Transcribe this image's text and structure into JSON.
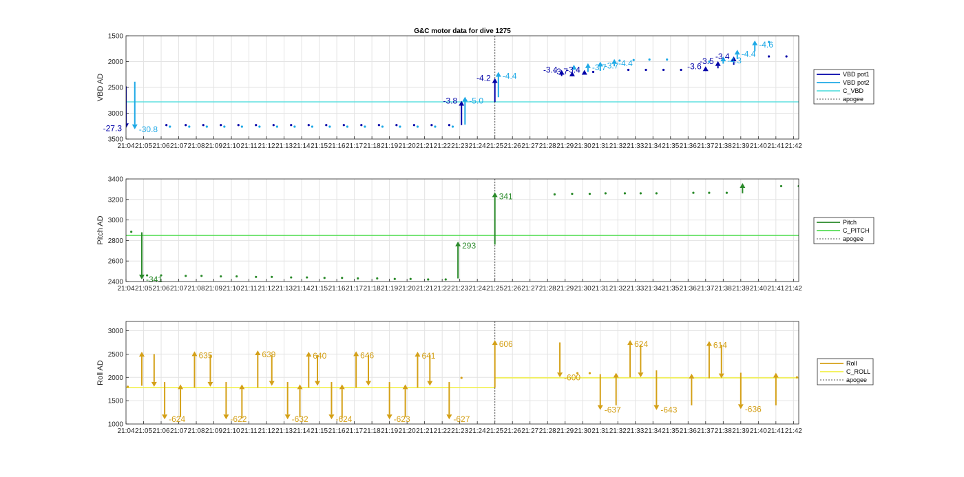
{
  "chart_data": [
    {
      "type": "scatter",
      "title": "G&C motor data for dive 1275",
      "ylabel": "VBD AD",
      "xlabel": "",
      "y_reversed": true,
      "ylim": [
        1500,
        3500
      ],
      "yticks": [
        1500,
        2000,
        2500,
        3000,
        3500
      ],
      "xticks": [
        "21:04",
        "21:05",
        "21:06",
        "21:07",
        "21:08",
        "21:09",
        "21:10",
        "21:11",
        "21:12",
        "21:13",
        "21:14",
        "21:15",
        "21:16",
        "21:17",
        "21:18",
        "21:19",
        "21:20",
        "21:21",
        "21:22",
        "21:23",
        "21:24",
        "21:25",
        "21:26",
        "21:27",
        "21:28",
        "21:29",
        "21:30",
        "21:31",
        "21:32",
        "21:33",
        "21:34",
        "21:35",
        "21:36",
        "21:37",
        "21:38",
        "21:39",
        "21:40",
        "21:41",
        "21:42"
      ],
      "grid": true,
      "legend": {
        "placement": "right",
        "entries": [
          "VBD pot1",
          "VBD pot2",
          "C_VBD",
          "apogee"
        ]
      },
      "colors": {
        "pot1": "#0000a8",
        "pot2": "#1ea9e6",
        "c_line": "#5fe0e0",
        "apogee": "#555555"
      },
      "apogee_min": 25.0,
      "c_value": 2780,
      "series": [
        {
          "name": "VBD pot1",
          "points": [
            [
              6.3,
              3230
            ],
            [
              7.4,
              3230
            ],
            [
              8.4,
              3230
            ],
            [
              9.4,
              3230
            ],
            [
              10.4,
              3230
            ],
            [
              11.4,
              3230
            ],
            [
              12.4,
              3230
            ],
            [
              13.4,
              3230
            ],
            [
              14.4,
              3230
            ],
            [
              15.4,
              3230
            ],
            [
              16.4,
              3230
            ],
            [
              17.4,
              3230
            ],
            [
              18.4,
              3230
            ],
            [
              19.4,
              3230
            ],
            [
              20.4,
              3230
            ],
            [
              21.4,
              3230
            ],
            [
              22.4,
              3230
            ],
            [
              30.6,
              2200
            ],
            [
              32.6,
              2160
            ],
            [
              33.6,
              2160
            ],
            [
              34.6,
              2160
            ],
            [
              35.6,
              2160
            ],
            [
              40.6,
              1900
            ],
            [
              41.6,
              1900
            ]
          ],
          "arrows": [
            {
              "x0": 4.0,
              "y0": 2480,
              "y1": 3290,
              "label": "-27.3"
            },
            {
              "x0": 23.1,
              "y0": 3230,
              "y1": 2760,
              "label": "-3.8"
            },
            {
              "x0": 25.0,
              "y0": 2780,
              "y1": 2320,
              "label": "-4.2"
            },
            {
              "x0": 28.8,
              "y0": 2280,
              "y1": 2160,
              "label": "-3.4"
            },
            {
              "x0": 29.4,
              "y0": 2270,
              "y1": 2190,
              "label": "-3.7"
            },
            {
              "x0": 30.1,
              "y0": 2240,
              "y1": 2160,
              "label": "-3.4"
            },
            {
              "x0": 37.0,
              "y0": 2160,
              "y1": 2090,
              "label": "-3.6"
            },
            {
              "x0": 37.7,
              "y0": 2130,
              "y1": 1990,
              "label": "-3.5"
            },
            {
              "x0": 38.6,
              "y0": 2060,
              "y1": 1900,
              "label": "-3.4"
            }
          ]
        },
        {
          "name": "VBD pot2",
          "points": [
            [
              6.5,
              3260
            ],
            [
              7.6,
              3260
            ],
            [
              8.6,
              3260
            ],
            [
              9.6,
              3260
            ],
            [
              10.6,
              3260
            ],
            [
              11.6,
              3260
            ],
            [
              12.6,
              3260
            ],
            [
              13.6,
              3260
            ],
            [
              14.6,
              3260
            ],
            [
              15.6,
              3260
            ],
            [
              16.6,
              3260
            ],
            [
              17.6,
              3260
            ],
            [
              18.6,
              3260
            ],
            [
              19.6,
              3260
            ],
            [
              20.6,
              3260
            ],
            [
              21.6,
              3260
            ],
            [
              22.6,
              3260
            ],
            [
              32.1,
              1980
            ],
            [
              32.9,
              1970
            ],
            [
              33.8,
              1960
            ],
            [
              34.8,
              1960
            ],
            [
              37.2,
              2000
            ],
            [
              40.6,
              1620
            ]
          ],
          "arrows": [
            {
              "x0": 4.5,
              "y0": 2390,
              "y1": 3310,
              "label": "-30.8"
            },
            {
              "x0": 23.3,
              "y0": 3220,
              "y1": 2680,
              "label": "-5.0"
            },
            {
              "x0": 25.2,
              "y0": 2690,
              "y1": 2200,
              "label": "-4.4"
            },
            {
              "x0": 29.5,
              "y0": 2160,
              "y1": 2060,
              "label": ""
            },
            {
              "x0": 30.3,
              "y0": 2200,
              "y1": 2030,
              "label": "-3.7"
            },
            {
              "x0": 31.0,
              "y0": 2180,
              "y1": 2000,
              "label": "-3.7"
            },
            {
              "x0": 31.8,
              "y0": 2090,
              "y1": 1950,
              "label": "-4.4"
            },
            {
              "x0": 38.0,
              "y0": 2040,
              "y1": 1900,
              "label": "-4.3"
            },
            {
              "x0": 38.8,
              "y0": 1950,
              "y1": 1770,
              "label": "-4.4"
            },
            {
              "x0": 39.8,
              "y0": 1800,
              "y1": 1590,
              "label": "-4.6"
            }
          ]
        }
      ]
    },
    {
      "type": "scatter",
      "title": "",
      "ylabel": "Pitch AD",
      "xlabel": "",
      "y_reversed": false,
      "ylim": [
        2400,
        3400
      ],
      "yticks": [
        2400,
        2600,
        2800,
        3000,
        3200,
        3400
      ],
      "xticks": [
        "21:04",
        "21:05",
        "21:06",
        "21:07",
        "21:08",
        "21:09",
        "21:10",
        "21:11",
        "21:12",
        "21:13",
        "21:14",
        "21:15",
        "21:16",
        "21:17",
        "21:18",
        "21:19",
        "21:20",
        "21:21",
        "21:22",
        "21:23",
        "21:24",
        "21:25",
        "21:26",
        "21:27",
        "21:28",
        "21:29",
        "21:30",
        "21:31",
        "21:32",
        "21:33",
        "21:34",
        "21:35",
        "21:36",
        "21:37",
        "21:38",
        "21:39",
        "21:40",
        "21:41",
        "21:42"
      ],
      "grid": true,
      "legend": {
        "placement": "right",
        "entries": [
          "Pitch",
          "C_PITCH",
          "apogee"
        ]
      },
      "colors": {
        "main": "#2a8a2a",
        "c_line": "#55dd55",
        "apogee": "#555555"
      },
      "apogee_min": 25.0,
      "c_value": 2850,
      "series": [
        {
          "name": "Pitch",
          "points": [
            [
              4.3,
              2885
            ],
            [
              5.2,
              2460
            ],
            [
              6.0,
              2460
            ],
            [
              7.4,
              2455
            ],
            [
              8.3,
              2455
            ],
            [
              9.4,
              2450
            ],
            [
              10.3,
              2450
            ],
            [
              11.4,
              2445
            ],
            [
              12.3,
              2445
            ],
            [
              13.4,
              2440
            ],
            [
              14.3,
              2440
            ],
            [
              15.3,
              2435
            ],
            [
              16.3,
              2435
            ],
            [
              17.2,
              2430
            ],
            [
              18.3,
              2430
            ],
            [
              19.3,
              2425
            ],
            [
              20.2,
              2425
            ],
            [
              21.2,
              2420
            ],
            [
              22.2,
              2420
            ],
            [
              28.4,
              3250
            ],
            [
              29.4,
              3255
            ],
            [
              30.4,
              3255
            ],
            [
              31.3,
              3260
            ],
            [
              32.4,
              3260
            ],
            [
              33.3,
              3260
            ],
            [
              34.2,
              3260
            ],
            [
              36.3,
              3265
            ],
            [
              37.2,
              3265
            ],
            [
              38.2,
              3265
            ],
            [
              41.3,
              3330
            ],
            [
              42.3,
              3330
            ]
          ],
          "arrows": [
            {
              "x0": 4.9,
              "y0": 2880,
              "y1": 2420,
              "label": "-341"
            },
            {
              "x0": 22.9,
              "y0": 2430,
              "y1": 2790,
              "label": "293"
            },
            {
              "x0": 25.0,
              "y0": 2760,
              "y1": 3270,
              "label": "341"
            },
            {
              "x0": 39.1,
              "y0": 3260,
              "y1": 3360,
              "label": ""
            }
          ]
        }
      ]
    },
    {
      "type": "scatter",
      "title": "",
      "ylabel": "Roll AD",
      "xlabel": "",
      "y_reversed": false,
      "ylim": [
        1000,
        3200
      ],
      "yticks": [
        1000,
        1500,
        2000,
        2500,
        3000
      ],
      "xticks": [
        "21:04",
        "21:05",
        "21:06",
        "21:07",
        "21:08",
        "21:09",
        "21:10",
        "21:11",
        "21:12",
        "21:13",
        "21:14",
        "21:15",
        "21:16",
        "21:17",
        "21:18",
        "21:19",
        "21:20",
        "21:21",
        "21:22",
        "21:23",
        "21:24",
        "21:25",
        "21:26",
        "21:27",
        "21:28",
        "21:29",
        "21:30",
        "21:31",
        "21:32",
        "21:33",
        "21:34",
        "21:35",
        "21:36",
        "21:37",
        "21:38",
        "21:39",
        "21:40",
        "21:41",
        "21:42"
      ],
      "grid": true,
      "legend": {
        "placement": "right",
        "entries": [
          "Roll",
          "C_ROLL",
          "apogee"
        ]
      },
      "colors": {
        "main": "#d4a017",
        "c_line": "#f2f04c",
        "apogee": "#555555"
      },
      "apogee_min": 25.0,
      "c_segments": [
        [
          4.0,
          25.0,
          1780
        ],
        [
          25.0,
          42.3,
          1990
        ]
      ],
      "series": [
        {
          "name": "Roll",
          "points": [
            [
              4.1,
              1800
            ],
            [
              23.1,
              1990
            ],
            [
              29.7,
              2090
            ],
            [
              30.4,
              2090
            ],
            [
              42.2,
              2000
            ]
          ],
          "arrows": [
            {
              "x0": 4.9,
              "y0": 1820,
              "y1": 2550,
              "label": ""
            },
            {
              "x0": 5.6,
              "y0": 2500,
              "y1": 1800,
              "label": ""
            },
            {
              "x0": 6.2,
              "y0": 1900,
              "y1": 1100,
              "label": "-624"
            },
            {
              "x0": 7.1,
              "y0": 1150,
              "y1": 1850,
              "label": ""
            },
            {
              "x0": 7.9,
              "y0": 1780,
              "y1": 2560,
              "label": "635"
            },
            {
              "x0": 8.8,
              "y0": 2480,
              "y1": 1800,
              "label": ""
            },
            {
              "x0": 9.7,
              "y0": 1900,
              "y1": 1100,
              "label": "-622"
            },
            {
              "x0": 10.6,
              "y0": 1120,
              "y1": 1850,
              "label": ""
            },
            {
              "x0": 11.5,
              "y0": 1780,
              "y1": 2580,
              "label": "639"
            },
            {
              "x0": 12.3,
              "y0": 2480,
              "y1": 1820,
              "label": ""
            },
            {
              "x0": 13.2,
              "y0": 1900,
              "y1": 1100,
              "label": "-632"
            },
            {
              "x0": 13.9,
              "y0": 1150,
              "y1": 1850,
              "label": ""
            },
            {
              "x0": 14.4,
              "y0": 1780,
              "y1": 2550,
              "label": "640"
            },
            {
              "x0": 14.9,
              "y0": 2480,
              "y1": 1820,
              "label": ""
            },
            {
              "x0": 15.7,
              "y0": 1900,
              "y1": 1100,
              "label": "-624"
            },
            {
              "x0": 16.3,
              "y0": 1120,
              "y1": 1850,
              "label": ""
            },
            {
              "x0": 17.1,
              "y0": 1780,
              "y1": 2560,
              "label": "646"
            },
            {
              "x0": 17.8,
              "y0": 2480,
              "y1": 1820,
              "label": ""
            },
            {
              "x0": 19.0,
              "y0": 1900,
              "y1": 1100,
              "label": "-623"
            },
            {
              "x0": 19.9,
              "y0": 1150,
              "y1": 1850,
              "label": ""
            },
            {
              "x0": 20.6,
              "y0": 1780,
              "y1": 2550,
              "label": "641"
            },
            {
              "x0": 21.3,
              "y0": 2480,
              "y1": 1820,
              "label": ""
            },
            {
              "x0": 22.4,
              "y0": 1900,
              "y1": 1100,
              "label": "-627"
            },
            {
              "x0": 25.0,
              "y0": 1780,
              "y1": 2800,
              "label": "606"
            },
            {
              "x0": 28.7,
              "y0": 2750,
              "y1": 2000,
              "label": "-600"
            },
            {
              "x0": 31.0,
              "y0": 2070,
              "y1": 1300,
              "label": "-637"
            },
            {
              "x0": 31.9,
              "y0": 1400,
              "y1": 2100,
              "label": ""
            },
            {
              "x0": 32.7,
              "y0": 2000,
              "y1": 2800,
              "label": "624"
            },
            {
              "x0": 33.3,
              "y0": 2700,
              "y1": 2000,
              "label": ""
            },
            {
              "x0": 34.2,
              "y0": 2150,
              "y1": 1300,
              "label": "-643"
            },
            {
              "x0": 36.2,
              "y0": 1400,
              "y1": 2080,
              "label": ""
            },
            {
              "x0": 37.2,
              "y0": 1980,
              "y1": 2780,
              "label": "614"
            },
            {
              "x0": 37.9,
              "y0": 2700,
              "y1": 1980,
              "label": ""
            },
            {
              "x0": 39.0,
              "y0": 2100,
              "y1": 1320,
              "label": "-636"
            },
            {
              "x0": 41.0,
              "y0": 1400,
              "y1": 2100,
              "label": ""
            }
          ]
        }
      ]
    }
  ]
}
